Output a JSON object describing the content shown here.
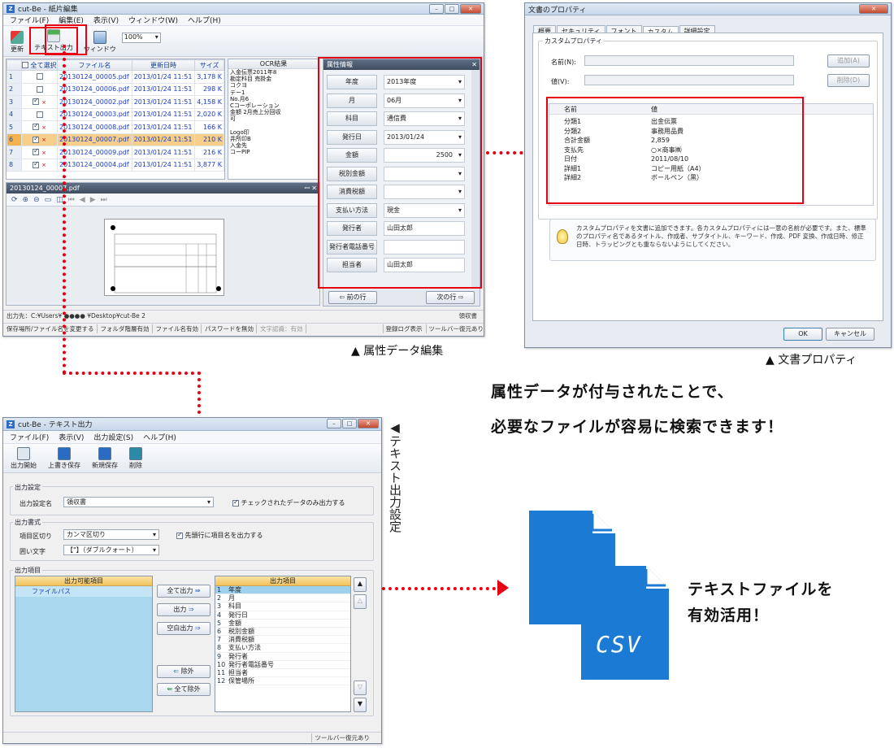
{
  "attr_window": {
    "title": "cut-Be - 紙片編集",
    "menu": [
      "ファイル(F)",
      "編集(E)",
      "表示(V)",
      "ウィンドウ(W)",
      "ヘルプ(H)"
    ],
    "toolbar": {
      "refresh": "更新",
      "text_out": "テキスト出力",
      "window": "ウィンドウ",
      "zoom": "100%"
    },
    "grid_headers": [
      "全て選択",
      "ファイル名",
      "更新日時",
      "サイズ"
    ],
    "rows": [
      {
        "n": "1",
        "checked": false,
        "file": "20130124_00005.pdf",
        "date": "2013/01/24 11:51",
        "size": "3,178 K"
      },
      {
        "n": "2",
        "checked": false,
        "file": "20130124_00006.pdf",
        "date": "2013/01/24 11:51",
        "size": "298 K"
      },
      {
        "n": "3",
        "checked": true,
        "file": "20130124_00002.pdf",
        "date": "2013/01/24 11:51",
        "size": "4,158 K"
      },
      {
        "n": "4",
        "checked": false,
        "file": "20130124_00003.pdf",
        "date": "2013/01/24 11:51",
        "size": "2,020 K"
      },
      {
        "n": "5",
        "checked": true,
        "file": "20130124_00008.pdf",
        "date": "2013/01/24 11:51",
        "size": "166 K"
      },
      {
        "n": "6",
        "checked": true,
        "file": "20130124_00007.pdf",
        "date": "2013/01/24 11:51",
        "size": "210 K"
      },
      {
        "n": "7",
        "checked": true,
        "file": "20130124_00009.pdf",
        "date": "2013/01/24 11:51",
        "size": "216 K"
      },
      {
        "n": "8",
        "checked": true,
        "file": "20130124_00004.pdf",
        "date": "2013/01/24 11:51",
        "size": "3,877 K"
      }
    ],
    "ocr_header": "OCR結果",
    "ocr_lines": [
      "入金伝票2011年8",
      "勘定科目 売掛金",
      "コクヨ",
      "テー1",
      "No.月6",
      "Cコーポレーション",
      "金額 2月売上分回収",
      "可",
      "",
      "Logo印",
      "井所印B",
      "入金先",
      "コーPIP"
    ],
    "preview_title": "20130124_00007.pdf",
    "attr_panel_title": "属性情報",
    "attrs": [
      {
        "label": "年度",
        "value": "2013年度",
        "dd": true
      },
      {
        "label": "月",
        "value": "06月",
        "dd": true
      },
      {
        "label": "科目",
        "value": "通信費",
        "dd": true
      },
      {
        "label": "発行日",
        "value": "2013/01/24",
        "dd": true
      },
      {
        "label": "金額",
        "value": "2500",
        "dd": true
      },
      {
        "label": "税別金額",
        "value": "",
        "dd": true
      },
      {
        "label": "消費税額",
        "value": "",
        "dd": true
      },
      {
        "label": "支払い方法",
        "value": "現金",
        "dd": true
      },
      {
        "label": "発行者",
        "value": "山田太郎",
        "dd": false
      },
      {
        "label": "発行者電話番号",
        "value": "",
        "dd": false
      },
      {
        "label": "担当者",
        "value": "山田太郎",
        "dd": false
      }
    ],
    "prev_row": "前の行",
    "next_row": "次の行",
    "output_path": "出力先：C:¥Users¥ ●●●● ¥Desktop¥cut-Be 2",
    "doc_type": "領収書",
    "status_items": [
      "保存場所/ファイル名を変更する",
      "フォルダ階層有効",
      "ファイル名有効",
      "パスワードを無効",
      "文字認識：有効"
    ],
    "status_right": [
      "登録ログ表示",
      "ツールバー復元あり"
    ],
    "caption": "▲ 属性データ編集"
  },
  "doc_props": {
    "title": "文書のプロパティ",
    "tabs": [
      "概要",
      "セキュリティ",
      "フォント",
      "カスタム",
      "詳細設定"
    ],
    "group": "カスタムプロパティ",
    "name_label": "名前(N):",
    "value_label": "値(V):",
    "add_btn": "追加(A)",
    "del_btn": "削除(D)",
    "col_name": "名前",
    "col_value": "値",
    "props": [
      {
        "name": "分類1",
        "value": "出金伝票"
      },
      {
        "name": "分類2",
        "value": "事務用品費"
      },
      {
        "name": "合計金額",
        "value": "2,859"
      },
      {
        "name": "支払先",
        "value": "○×商事㈱"
      },
      {
        "name": "日付",
        "value": "2011/08/10"
      },
      {
        "name": "詳細1",
        "value": "コピー用紙（A4）"
      },
      {
        "name": "詳細2",
        "value": "ボールペン（黒）"
      }
    ],
    "hint": "カスタムプロパティを文書に追加できます。各カスタムプロパティには一意の名前が必要です。また、標準のプロパティ名であるタイトル、作成者、サブタイトル、キーワード、作成、PDF 変換、作成日時、修正日時、トラッピングとも重ならないようにしてください。",
    "ok": "OK",
    "cancel": "キャンセル",
    "caption": "▲ 文書プロパティ"
  },
  "headline": {
    "line1": "属性データが付与されたことで、",
    "line2": "必要なファイルが容易に検索できます！"
  },
  "text_out_window": {
    "title": "cut-Be - テキスト出力",
    "menu": [
      "ファイル(F)",
      "表示(V)",
      "出力設定(S)",
      "ヘルプ(H)"
    ],
    "toolbar": [
      "出力開始",
      "上書き保存",
      "新規保存",
      "削除"
    ],
    "sec_setting": "出力設定",
    "setting_name_label": "出力設定名",
    "setting_name_value": "領収書",
    "only_checked": "チェックされたデータのみ出力する",
    "sec_format": "出力書式",
    "delim_label": "項目区切り",
    "delim_value": "カンマ区切り",
    "header_row": "先頭行に項目名を出力する",
    "quote_label": "囲い文字",
    "quote_value": "【\"】（ダブルクォート）",
    "sec_items": "出力項目",
    "avail_header": "出力可能項目",
    "avail_items": [
      "ファイルパス"
    ],
    "btn_all_out": "全て出力",
    "btn_out": "出力",
    "btn_blank": "空白出力",
    "btn_remove": "除外",
    "btn_remove_all": "全て除外",
    "out_header": "出力項目",
    "out_items": [
      {
        "n": "1",
        "label": "年度"
      },
      {
        "n": "2",
        "label": "月"
      },
      {
        "n": "3",
        "label": "科目"
      },
      {
        "n": "4",
        "label": "発行日"
      },
      {
        "n": "5",
        "label": "金額"
      },
      {
        "n": "6",
        "label": "税別金額"
      },
      {
        "n": "7",
        "label": "消費税額"
      },
      {
        "n": "8",
        "label": "支払い方法"
      },
      {
        "n": "9",
        "label": "発行者"
      },
      {
        "n": "10",
        "label": "発行者電話番号"
      },
      {
        "n": "11",
        "label": "担当者"
      },
      {
        "n": "12",
        "label": "保管場所"
      }
    ],
    "status": "ツールバー復元あり",
    "caption": "◀テキスト出力設定"
  },
  "csv": {
    "label": "CSV",
    "line1": "テキストファイルを",
    "line2": "有効活用！"
  },
  "colors": {
    "accent_red": "#e60012",
    "file_blue": "#1b7bd4"
  }
}
